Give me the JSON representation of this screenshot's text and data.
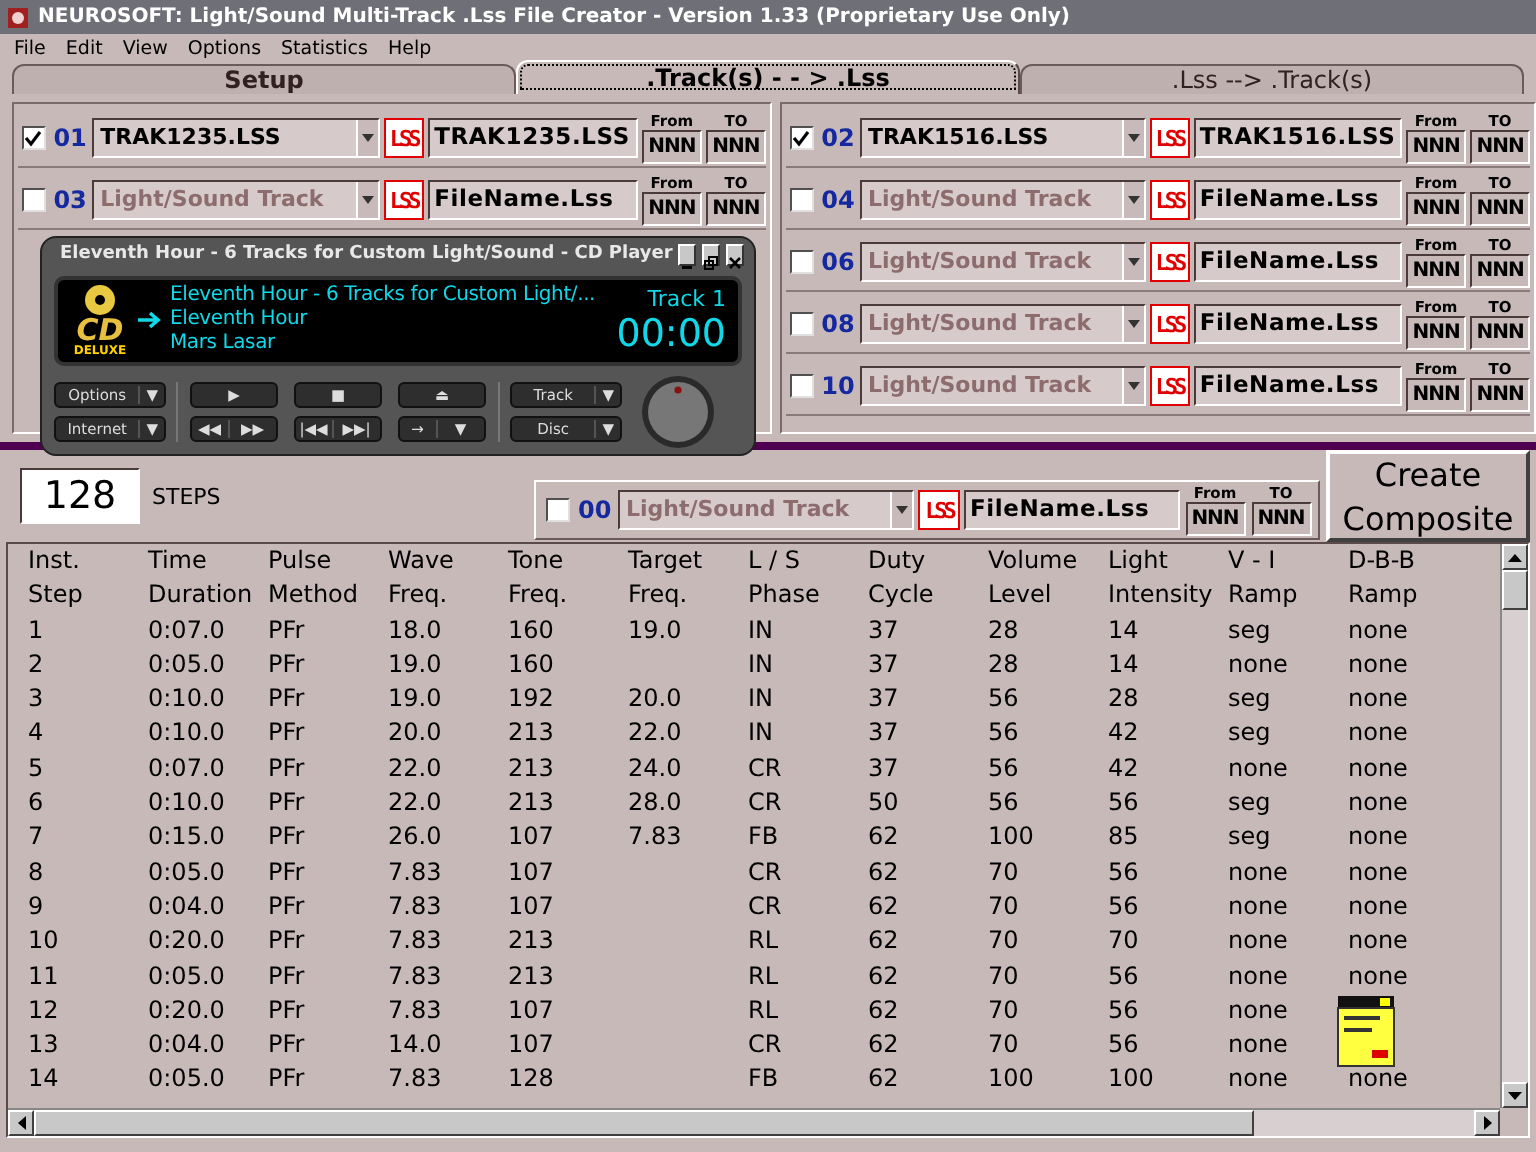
{
  "window": {
    "title": "NEUROSOFT: Light/Sound  Multi-Track  .Lss File Creator - Version 1.33 (Proprietary Use Only)"
  },
  "menu": [
    "File",
    "Edit",
    "View",
    "Options",
    "Statistics",
    "Help"
  ],
  "tabs": [
    {
      "label": "Setup",
      "selected": false
    },
    {
      "label": ".Track(s) - - > .Lss",
      "selected": true
    },
    {
      "label": ".Lss --> .Track(s)",
      "selected": false
    }
  ],
  "tracks_left": [
    {
      "number": "01",
      "checked": true,
      "value": "TRAK1235.LSS",
      "logo": "LSS",
      "file": "TRAK1235.LSS",
      "from_label": "From",
      "from": "NNN",
      "to_label": "TO",
      "to": "NNN"
    },
    {
      "number": "03",
      "checked": false,
      "placeholder": "Light/Sound Track",
      "logo": "LSS",
      "file": "FileName.Lss",
      "from_label": "From",
      "from": "NNN",
      "to_label": "TO",
      "to": "NNN"
    }
  ],
  "tracks_right": [
    {
      "number": "02",
      "checked": true,
      "value": "TRAK1516.LSS",
      "logo": "LSS",
      "file": "TRAK1516.LSS",
      "from_label": "From",
      "from": "NNN",
      "to_label": "TO",
      "to": "NNN"
    },
    {
      "number": "04",
      "checked": false,
      "placeholder": "Light/Sound Track",
      "logo": "LSS",
      "file": "FileName.Lss",
      "from_label": "From",
      "from": "NNN",
      "to_label": "TO",
      "to": "NNN"
    },
    {
      "number": "06",
      "checked": false,
      "placeholder": "Light/Sound Track",
      "logo": "LSS",
      "file": "FileName.Lss",
      "from_label": "From",
      "from": "NNN",
      "to_label": "TO",
      "to": "NNN"
    },
    {
      "number": "08",
      "checked": false,
      "placeholder": "Light/Sound Track",
      "logo": "LSS",
      "file": "FileName.Lss",
      "from_label": "From",
      "from": "NNN",
      "to_label": "TO",
      "to": "NNN"
    },
    {
      "number": "10",
      "checked": false,
      "placeholder": "Light/Sound Track",
      "logo": "LSS",
      "file": "FileName.Lss",
      "from_label": "From",
      "from": "NNN",
      "to_label": "TO",
      "to": "NNN"
    }
  ],
  "steps": {
    "value": "128",
    "label": "STEPS"
  },
  "composite_track": {
    "number": "00",
    "checked": false,
    "placeholder": "Light/Sound Track",
    "logo": "LSS",
    "file": "FileName.Lss",
    "from_label": "From",
    "from": "NNN",
    "to_label": "TO",
    "to": "NNN"
  },
  "create_button": "Create Composite",
  "table": {
    "columns": [
      {
        "top": "Inst.",
        "bottom": "Step"
      },
      {
        "top": "Time",
        "bottom": "Duration"
      },
      {
        "top": "Pulse",
        "bottom": "Method"
      },
      {
        "top": "Wave",
        "bottom": "Freq."
      },
      {
        "top": "Tone",
        "bottom": "Freq."
      },
      {
        "top": "Target",
        "bottom": "Freq."
      },
      {
        "top": "L / S",
        "bottom": "Phase"
      },
      {
        "top": "Duty",
        "bottom": "Cycle"
      },
      {
        "top": "Volume",
        "bottom": "Level"
      },
      {
        "top": "Light",
        "bottom": "Intensity"
      },
      {
        "top": "V - I",
        "bottom": "Ramp"
      },
      {
        "top": "D-B-B",
        "bottom": "Ramp"
      }
    ],
    "rows": [
      [
        "1",
        "0:07.0",
        "PFr",
        "18.0",
        "160",
        "19.0",
        "IN",
        "37",
        "28",
        "14",
        "seg",
        "none"
      ],
      [
        "2",
        "0:05.0",
        "PFr",
        "19.0",
        "160",
        null,
        "IN",
        "37",
        "28",
        "14",
        "none",
        "none"
      ],
      [
        "3",
        "0:10.0",
        "PFr",
        "19.0",
        "192",
        "20.0",
        "IN",
        "37",
        "56",
        "28",
        "seg",
        "none"
      ],
      [
        "4",
        "0:10.0",
        "PFr",
        "20.0",
        "213",
        "22.0",
        "IN",
        "37",
        "56",
        "42",
        "seg",
        "none"
      ],
      [
        "5",
        "0:07.0",
        "PFr",
        "22.0",
        "213",
        "24.0",
        "CR",
        "37",
        "56",
        "42",
        "none",
        "none"
      ],
      [
        "6",
        "0:10.0",
        "PFr",
        "22.0",
        "213",
        "28.0",
        "CR",
        "50",
        "56",
        "56",
        "seg",
        "none"
      ],
      [
        "7",
        "0:15.0",
        "PFr",
        "26.0",
        "107",
        "7.83",
        "FB",
        "62",
        "100",
        "85",
        "seg",
        "none"
      ],
      [
        "8",
        "0:05.0",
        "PFr",
        "7.83",
        "107",
        null,
        "CR",
        "62",
        "70",
        "56",
        "none",
        "none"
      ],
      [
        "9",
        "0:04.0",
        "PFr",
        "7.83",
        "107",
        null,
        "CR",
        "62",
        "70",
        "56",
        "none",
        "none"
      ],
      [
        "10",
        "0:20.0",
        "PFr",
        "7.83",
        "213",
        null,
        "RL",
        "62",
        "70",
        "70",
        "none",
        "none"
      ],
      [
        "11",
        "0:05.0",
        "PFr",
        "7.83",
        "213",
        null,
        "RL",
        "62",
        "70",
        "56",
        "none",
        "none"
      ],
      [
        "12",
        "0:20.0",
        "PFr",
        "7.83",
        "107",
        null,
        "RL",
        "62",
        "70",
        "56",
        "none",
        null
      ],
      [
        "13",
        "0:04.0",
        "PFr",
        "14.0",
        "107",
        null,
        "CR",
        "62",
        "70",
        "56",
        "none",
        null
      ],
      [
        "14",
        "0:05.0",
        "PFr",
        "7.83",
        "128",
        null,
        "FB",
        "62",
        "100",
        "100",
        "none",
        "none"
      ]
    ]
  },
  "player": {
    "title": "Eleventh Hour - 6 Tracks for Custom Light/Sound - CD Player",
    "logo_top": "CD",
    "logo_bottom": "DELUXE",
    "lines": [
      "Eleventh Hour - 6 Tracks for Custom Light/...",
      "Eleventh Hour",
      "Mars Lasar"
    ],
    "track": "Track 1",
    "time": "00:00",
    "left_buttons": [
      {
        "parts": [
          "Options",
          "▼"
        ]
      },
      {
        "parts": [
          "Internet",
          "▼"
        ]
      }
    ],
    "transport": [
      {
        "parts": [
          "▶"
        ]
      },
      {
        "parts": [
          "■"
        ]
      },
      {
        "parts": [
          "⏏"
        ]
      },
      {
        "parts": [
          "◀◀",
          "▶▶"
        ]
      },
      {
        "parts": [
          "|◀◀",
          "▶▶|"
        ]
      },
      {
        "parts": [
          "→",
          "▼"
        ]
      }
    ],
    "right_buttons": [
      {
        "parts": [
          "Track",
          "▼"
        ]
      },
      {
        "parts": [
          "Disc",
          "▼"
        ]
      }
    ]
  }
}
